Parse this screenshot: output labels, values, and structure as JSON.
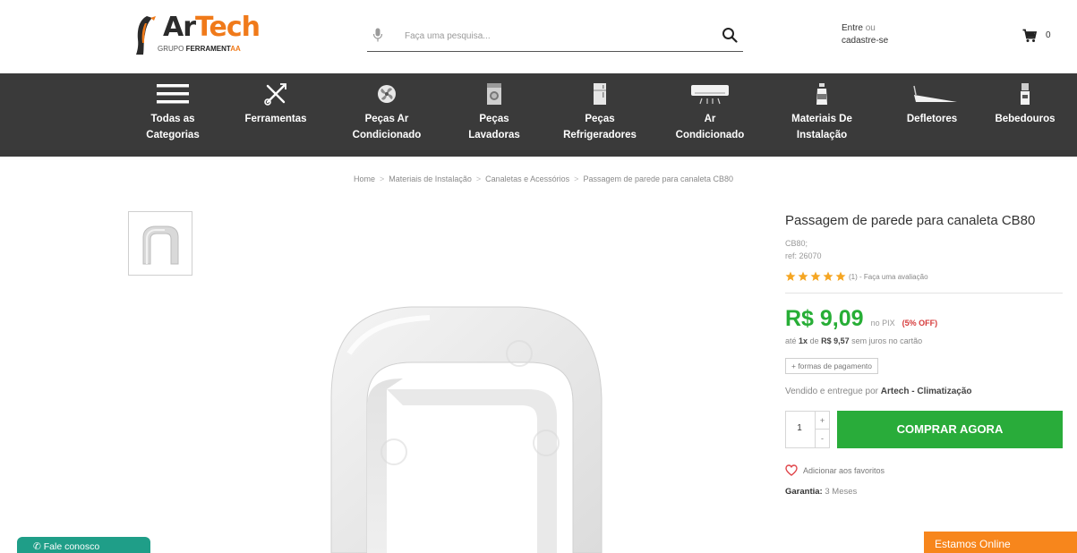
{
  "header": {
    "logo_part1": "Ar",
    "logo_part2": "Tech",
    "logo_sub_prefix": "GRUPO",
    "logo_sub_brand1": "FERRAMENT",
    "logo_sub_brand2": "AA",
    "search_placeholder": "Faça uma pesquisa...",
    "login_enter": "Entre",
    "login_or": "ou",
    "login_register": "cadastre-se",
    "cart_count": "0"
  },
  "nav": {
    "items": [
      {
        "label": "Todas as\nCategorias",
        "icon": "menu-icon"
      },
      {
        "label": "Ferramentas",
        "icon": "tools-icon"
      },
      {
        "label": "Peças Ar\nCondicionado",
        "icon": "fan-icon"
      },
      {
        "label": "Peças\nLavadoras",
        "icon": "washer-icon"
      },
      {
        "label": "Peças\nRefrigeradores",
        "icon": "fridge-icon"
      },
      {
        "label": "Ar\nCondicionado",
        "icon": "air-conditioner-icon"
      },
      {
        "label": "Materiais De\nInstalação",
        "icon": "bottle-icon"
      },
      {
        "label": "Defletores",
        "icon": "deflector-icon"
      },
      {
        "label": "Bebedouros",
        "icon": "water-cooler-icon"
      }
    ]
  },
  "breadcrumb": {
    "items": [
      "Home",
      "Materiais de Instalação",
      "Canaletas e Acessórios",
      "Passagem de parede para canaleta CB80"
    ],
    "separator": ">"
  },
  "product": {
    "title": "Passagem de parede para canaleta CB80",
    "sku": "CB80;",
    "ref": "ref: 26070",
    "rating_count": "(1)",
    "rating_sep": "-",
    "rating_link": "Faça uma avaliação",
    "stars": 5,
    "price": "R$ 9,09",
    "price_method": "no PIX",
    "discount": "(5% OFF)",
    "installment_prefix": "até",
    "installment_count": "1x",
    "installment_de": "de",
    "installment_value": "R$ 9,57",
    "installment_suffix": "sem juros no cartão",
    "payment_button": "+ formas de pagamento",
    "seller_prefix": "Vendido e entregue por",
    "seller_name": "Artech",
    "seller_dash": "-",
    "seller_unit": "Climatização",
    "quantity": "1",
    "qty_plus": "+",
    "qty_minus": "-",
    "buy_button": "COMPRAR AGORA",
    "favorite": "Adicionar aos favoritos",
    "warranty_label": "Garantia:",
    "warranty_value": "3 Meses"
  },
  "floating": {
    "chat": "Fale conosco",
    "online": "Estamos Online"
  },
  "colors": {
    "nav_bg": "#3a3a3a",
    "brand_orange": "#f07a1a",
    "price_green": "#27ae36",
    "buy_green": "#29ac3a",
    "discount_red": "#d63b3b",
    "chat_teal": "#1f9e88",
    "online_orange": "#f7861c",
    "star": "#f5a623"
  }
}
